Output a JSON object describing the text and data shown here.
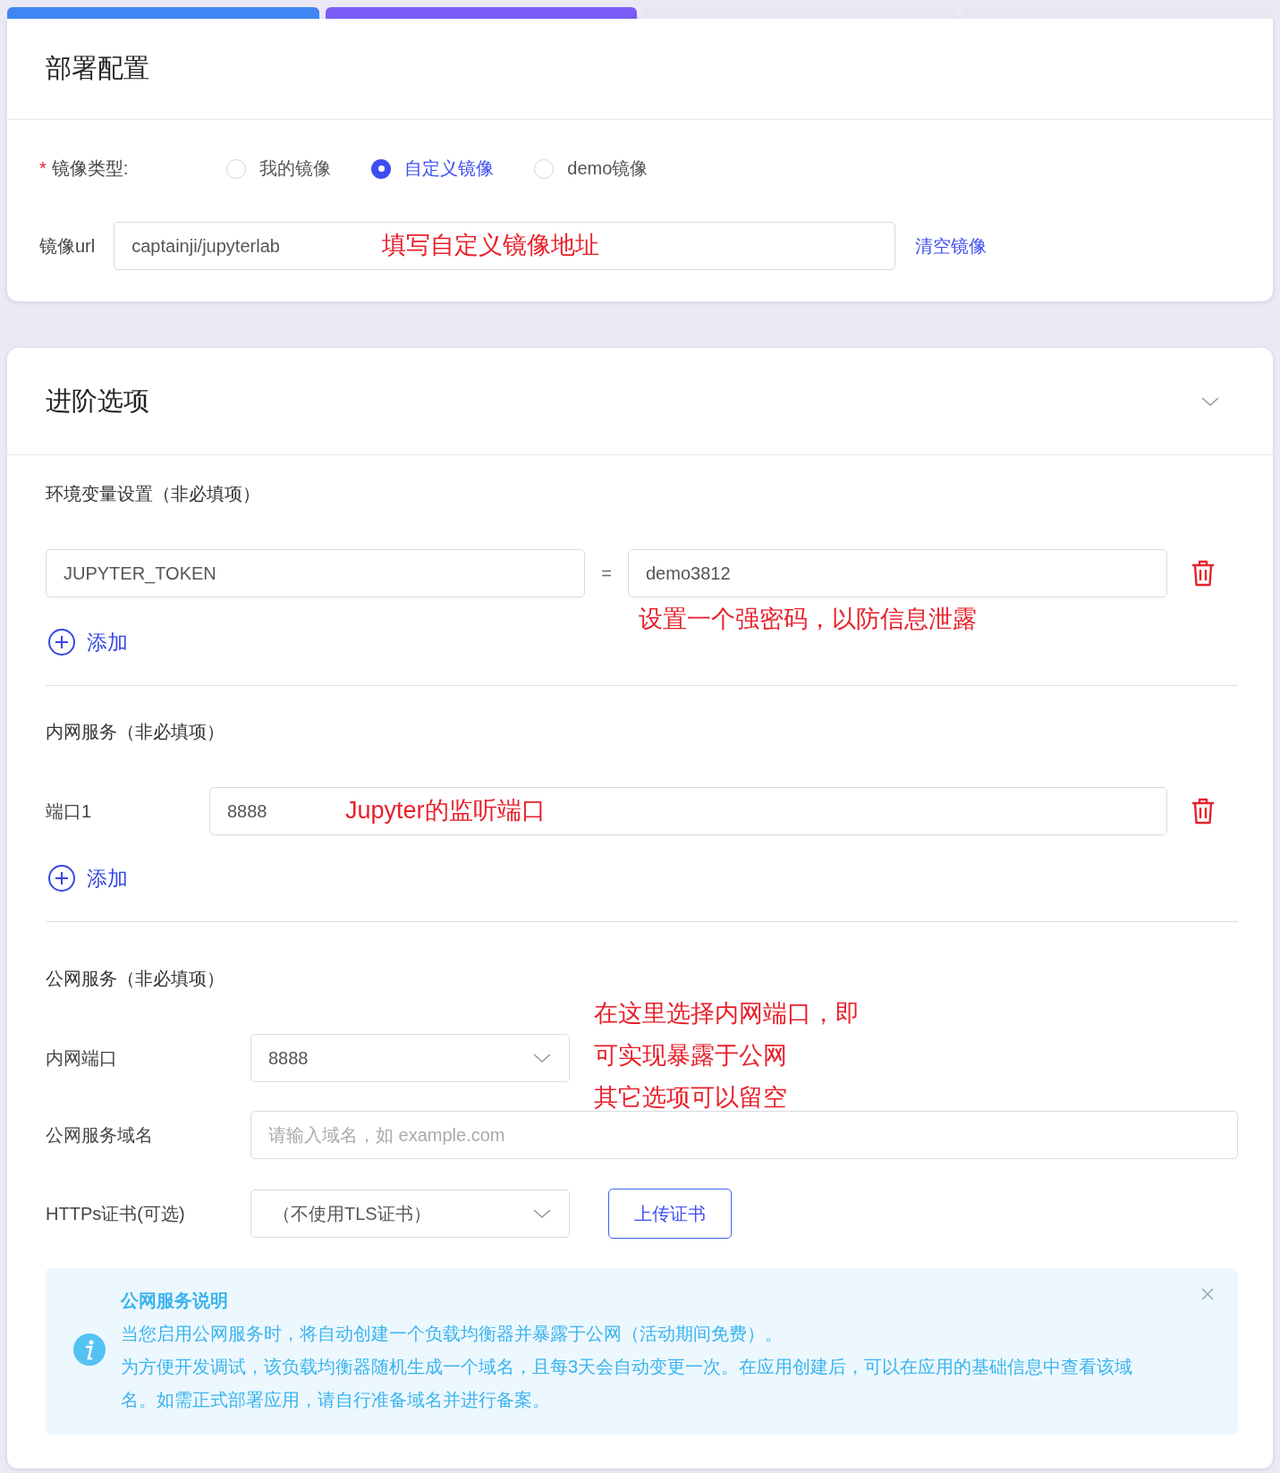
{
  "steps": [
    {
      "color": "#3f86f4"
    },
    {
      "color": "#7a5cf5"
    },
    {
      "color": "#e7e7f1"
    },
    {
      "color": "#e7e7f1"
    }
  ],
  "deploy_config": {
    "title": "部署配置",
    "image_type": {
      "required_mark": "*",
      "label": "镜像类型:",
      "options": [
        {
          "label": "我的镜像",
          "selected": false
        },
        {
          "label": "自定义镜像",
          "selected": true
        },
        {
          "label": "demo镜像",
          "selected": false
        }
      ]
    },
    "image_url": {
      "label": "镜像url",
      "value": "captainji/jupyterlab",
      "annotation": "填写自定义镜像地址",
      "clear_link": "清空镜像"
    }
  },
  "advanced": {
    "title": "进阶选项",
    "expanded": true,
    "env": {
      "title": "环境变量设置（非必填项）",
      "rows": [
        {
          "key": "JUPYTER_TOKEN",
          "separator": "=",
          "value": "demo3812"
        }
      ],
      "annotation": "设置一个强密码，以防信息泄露",
      "add": "添加"
    },
    "internal": {
      "title": "内网服务（非必填项）",
      "ports": [
        {
          "label": "端口1",
          "value": "8888",
          "annotation": "Jupyter的监听端口"
        }
      ],
      "add": "添加"
    },
    "public": {
      "title": "公网服务（非必填项）",
      "internal_port": {
        "label": "内网端口",
        "value": "8888"
      },
      "annotation": [
        "在这里选择内网端口，即",
        "可实现暴露于公网",
        "其它选项可以留空"
      ],
      "domain": {
        "label": "公网服务域名",
        "placeholder": "请输入域名，如 example.com"
      },
      "https": {
        "label": "HTTPs证书(可选)",
        "value": "（不使用TLS证书）",
        "upload": "上传证书"
      },
      "notice": {
        "title": "公网服务说明",
        "paragraphs": [
          "当您启用公网服务时，将自动创建一个负载均衡器并暴露于公网（活动期间免费）。",
          "为方便开发调试，该负载均衡器随机生成一个域名，且每3天会自动变更一次。在应用创建后，可以在应用的基础信息中查看该域名。如需正式部署应用，请自行准备域名并进行备案。"
        ]
      }
    }
  }
}
